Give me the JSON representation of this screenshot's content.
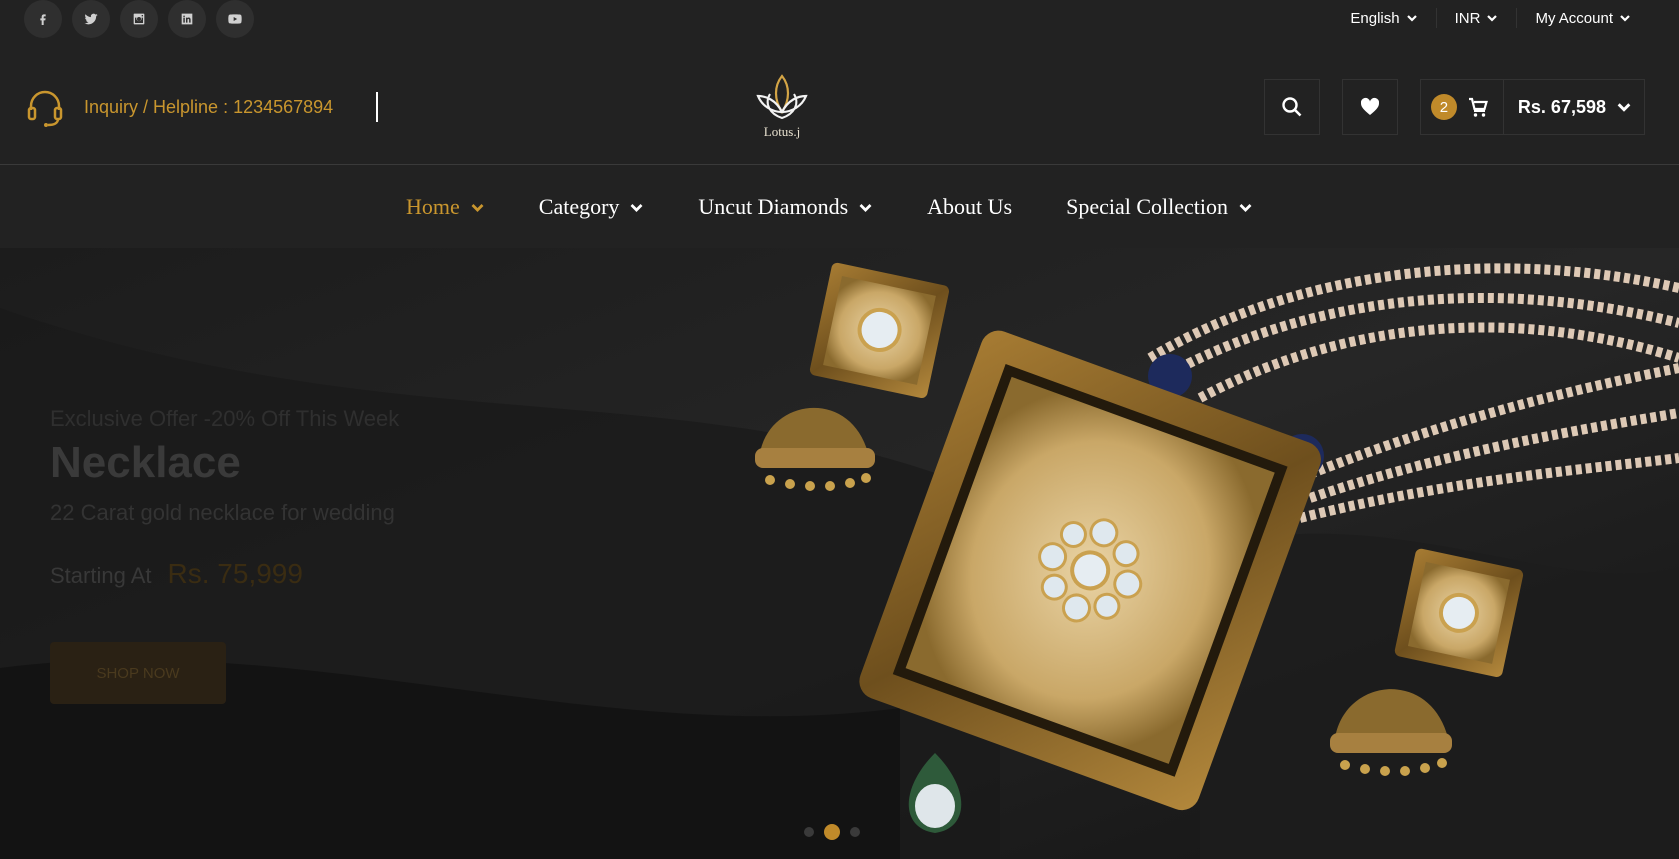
{
  "topbar": {
    "social": [
      {
        "name": "facebook-icon",
        "glyph": "f"
      },
      {
        "name": "twitter-icon",
        "glyph": "t"
      },
      {
        "name": "instagram-icon",
        "glyph": "i"
      },
      {
        "name": "linkedin-icon",
        "glyph": "in"
      },
      {
        "name": "youtube-icon",
        "glyph": "y"
      }
    ],
    "language": "English",
    "currency": "INR",
    "account": "My Account"
  },
  "header": {
    "helpline": "Inquiry / Helpline : 1234567894",
    "logo_text": "Lotus.j",
    "cart_count": "2",
    "cart_total": "Rs. 67,598"
  },
  "nav": {
    "items": [
      {
        "label": "Home",
        "dropdown": true,
        "active": true
      },
      {
        "label": "Category",
        "dropdown": true
      },
      {
        "label": "Uncut Diamonds",
        "dropdown": true
      },
      {
        "label": "About Us",
        "dropdown": false
      },
      {
        "label": "Special Collection",
        "dropdown": true
      }
    ]
  },
  "hero": {
    "offer": "Exclusive Offer -20% Off This Week",
    "title": "Necklace",
    "subtitle": "22 Carat gold necklace for wedding",
    "starting_label": "Starting At",
    "price": "Rs. 75,999",
    "button": "SHOP NOW",
    "active_slide": 2,
    "slide_count": 3
  },
  "colors": {
    "accent": "#c9962e",
    "background": "#222222"
  }
}
